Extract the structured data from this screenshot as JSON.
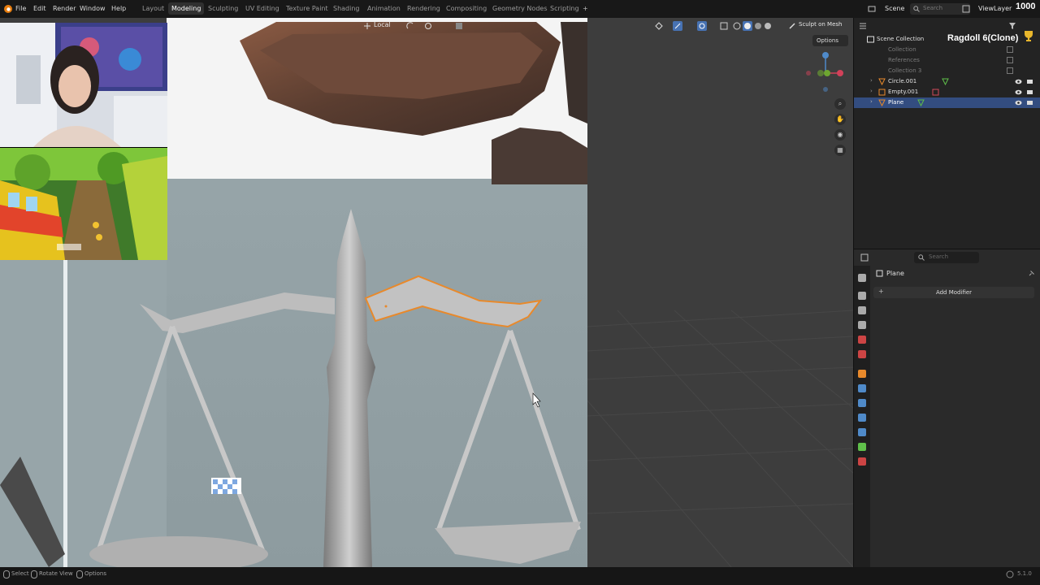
{
  "menu": {
    "file": "File",
    "edit": "Edit",
    "render": "Render",
    "window": "Window",
    "help": "Help"
  },
  "workspaces": [
    "Layout",
    "Modeling",
    "Sculpting",
    "UV Editing",
    "Texture Paint",
    "Shading",
    "Animation",
    "Rendering",
    "Compositing",
    "Geometry Nodes",
    "Scripting"
  ],
  "active_workspace": "Modeling",
  "scene": "Scene",
  "view_layer": "ViewLayer",
  "search_placeholder": "Search",
  "frame_counter": "1000",
  "viewport": {
    "pivot_label": "Local",
    "sculpt_on_mesh": "Sculpt on Mesh",
    "options": "Options"
  },
  "outliner": {
    "scene_collection": "Scene Collection",
    "title_overlay": "Ragdoll 6(Clone)",
    "rows": [
      {
        "label": "Collection",
        "dim": true
      },
      {
        "label": "References",
        "dim": true
      },
      {
        "label": "Collection 3",
        "dim": true
      },
      {
        "label": "Circle.001",
        "dim": false
      },
      {
        "label": "Empty.001",
        "dim": false
      },
      {
        "label": "Plane",
        "dim": false,
        "selected": true
      }
    ]
  },
  "properties": {
    "search_placeholder": "Search",
    "object_name": "Plane",
    "add_modifier": "Add Modifier"
  },
  "statusbar": {
    "select": "Select",
    "rotate_view": "Rotate View",
    "options": "Options",
    "version": "5.1.0"
  },
  "colors": {
    "accent_selected": "#334d80",
    "selection_outline": "#e8892b",
    "viewport_bg": "#3a3a3a"
  }
}
